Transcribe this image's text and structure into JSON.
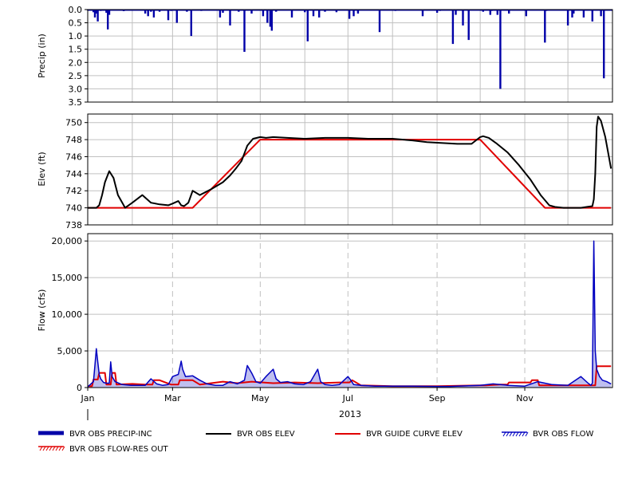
{
  "colors": {
    "precip": "#0000a8",
    "elev": "#000000",
    "guide": "#e00000",
    "flow": "#0000c0",
    "flow_res_out": "#e00000",
    "grid": "#c0c0c0"
  },
  "chart_data": [
    {
      "type": "bar",
      "panel": "precip",
      "ylabel": "Precip (in)",
      "ylim": [
        0.0,
        3.5
      ],
      "y_inverted": true,
      "yticks": [
        "0.0",
        "0.5",
        "1.0",
        "1.5",
        "2.0",
        "2.5",
        "3.0",
        "3.5"
      ],
      "grid": true,
      "series": [
        {
          "name": "BVR OBS PRECIP-INC",
          "x": [
            "2013-01-01",
            "2013-01-05",
            "2013-01-06",
            "2013-01-07",
            "2013-01-08",
            "2013-01-10",
            "2013-01-14",
            "2013-01-15",
            "2013-01-16",
            "2013-01-26",
            "2013-02-10",
            "2013-02-12",
            "2013-02-14",
            "2013-02-16",
            "2013-02-20",
            "2013-02-26",
            "2013-02-28",
            "2013-03-04",
            "2013-03-11",
            "2013-03-14",
            "2013-03-21",
            "2013-04-03",
            "2013-04-05",
            "2013-04-10",
            "2013-04-16",
            "2013-04-20",
            "2013-04-25",
            "2013-05-03",
            "2013-05-06",
            "2013-05-08",
            "2013-05-09",
            "2013-05-12",
            "2013-05-23",
            "2013-06-01",
            "2013-06-03",
            "2013-06-07",
            "2013-06-11",
            "2013-06-15",
            "2013-06-23",
            "2013-07-02",
            "2013-07-05",
            "2013-07-08",
            "2013-07-23",
            "2013-08-03",
            "2013-08-22",
            "2013-09-01",
            "2013-09-03",
            "2013-09-12",
            "2013-09-14",
            "2013-09-19",
            "2013-09-23",
            "2013-10-03",
            "2013-10-08",
            "2013-10-09",
            "2013-10-13",
            "2013-10-15",
            "2013-10-21",
            "2013-11-02",
            "2013-11-15",
            "2013-11-16",
            "2013-12-01",
            "2013-12-04",
            "2013-12-05",
            "2013-12-12",
            "2013-12-18",
            "2013-12-24",
            "2013-12-26"
          ],
          "values": [
            0.02,
            0.1,
            0.3,
            0.15,
            0.45,
            0.05,
            0.12,
            0.75,
            0.2,
            0.06,
            0.15,
            0.25,
            0.08,
            0.3,
            0.08,
            0.4,
            0.05,
            0.5,
            0.08,
            1.0,
            0.05,
            0.3,
            0.12,
            0.6,
            0.08,
            1.6,
            0.15,
            0.25,
            0.5,
            0.65,
            0.8,
            0.08,
            0.3,
            0.1,
            1.2,
            0.25,
            0.3,
            0.08,
            0.1,
            0.35,
            0.25,
            0.15,
            0.85,
            0.05,
            0.25,
            0.12,
            0.05,
            1.3,
            0.2,
            0.6,
            1.15,
            0.08,
            0.2,
            0.05,
            0.2,
            3.0,
            0.15,
            0.25,
            1.25,
            0.05,
            0.6,
            0.3,
            0.15,
            0.3,
            0.45,
            0.25,
            2.6
          ]
        }
      ]
    },
    {
      "type": "line",
      "panel": "elev",
      "ylabel": "Elev (ft)",
      "ylim": [
        738,
        751
      ],
      "yticks": [
        "738",
        "740",
        "742",
        "744",
        "746",
        "748",
        "750"
      ],
      "grid": true,
      "series": [
        {
          "name": "BVR OBS ELEV",
          "x": [
            "2013-01-01",
            "2013-01-07",
            "2013-01-09",
            "2013-01-11",
            "2013-01-13",
            "2013-01-16",
            "2013-01-19",
            "2013-01-22",
            "2013-01-27",
            "2013-02-01",
            "2013-02-08",
            "2013-02-14",
            "2013-02-20",
            "2013-02-26",
            "2013-03-01",
            "2013-03-05",
            "2013-03-07",
            "2013-03-09",
            "2013-03-12",
            "2013-03-15",
            "2013-03-20",
            "2013-03-28",
            "2013-04-05",
            "2013-04-10",
            "2013-04-14",
            "2013-04-18",
            "2013-04-22",
            "2013-04-26",
            "2013-05-01",
            "2013-05-05",
            "2013-05-10",
            "2013-05-20",
            "2013-06-01",
            "2013-06-15",
            "2013-07-01",
            "2013-07-15",
            "2013-08-01",
            "2013-08-15",
            "2013-08-25",
            "2013-09-05",
            "2013-09-15",
            "2013-09-25",
            "2013-10-01",
            "2013-10-03",
            "2013-10-07",
            "2013-10-12",
            "2013-10-20",
            "2013-10-28",
            "2013-11-05",
            "2013-11-12",
            "2013-11-18",
            "2013-11-22",
            "2013-11-28",
            "2013-12-05",
            "2013-12-10",
            "2013-12-14",
            "2013-12-18",
            "2013-12-19",
            "2013-12-20",
            "2013-12-21",
            "2013-12-22",
            "2013-12-24",
            "2013-12-27",
            "2013-12-31"
          ],
          "values": [
            740.0,
            740.0,
            740.3,
            741.5,
            743.0,
            744.3,
            743.5,
            741.5,
            740.0,
            740.6,
            741.5,
            740.6,
            740.4,
            740.3,
            740.5,
            740.8,
            740.3,
            740.2,
            740.6,
            742.0,
            741.5,
            742.2,
            743.0,
            743.8,
            744.6,
            745.5,
            747.3,
            748.1,
            748.3,
            748.2,
            748.3,
            748.2,
            748.1,
            748.2,
            748.2,
            748.1,
            748.1,
            747.9,
            747.7,
            747.6,
            747.5,
            747.5,
            748.3,
            748.4,
            748.2,
            747.6,
            746.5,
            745.0,
            743.3,
            741.5,
            740.3,
            740.1,
            740.0,
            740.0,
            740.0,
            740.1,
            740.2,
            741.0,
            744.0,
            749.5,
            750.7,
            750.2,
            748.3,
            744.6
          ]
        },
        {
          "name": "BVR GUIDE CURVE ELEV",
          "x": [
            "2013-01-01",
            "2013-03-15",
            "2013-05-01",
            "2013-10-01",
            "2013-11-15",
            "2013-12-31"
          ],
          "values": [
            740.0,
            740.0,
            748.0,
            748.0,
            740.0,
            740.0
          ]
        }
      ]
    },
    {
      "type": "line",
      "panel": "flow",
      "ylabel": "Flow (cfs)",
      "ylim": [
        0,
        21000
      ],
      "yticks": [
        "0",
        "5,000",
        "10,000",
        "15,000",
        "20,000"
      ],
      "grid": true,
      "xticks": [
        "Jan",
        "Mar",
        "May",
        "Jul",
        "Sep",
        "Nov"
      ],
      "xlabel": "2013",
      "series": [
        {
          "name": "BVR OBS FLOW",
          "x": [
            "2013-01-01",
            "2013-01-05",
            "2013-01-06",
            "2013-01-07",
            "2013-01-08",
            "2013-01-09",
            "2013-01-10",
            "2013-01-12",
            "2013-01-14",
            "2013-01-16",
            "2013-01-17",
            "2013-01-18",
            "2013-01-20",
            "2013-01-25",
            "2013-01-31",
            "2013-02-05",
            "2013-02-10",
            "2013-02-14",
            "2013-02-18",
            "2013-02-22",
            "2013-02-26",
            "2013-03-01",
            "2013-03-05",
            "2013-03-07",
            "2013-03-08",
            "2013-03-10",
            "2013-03-15",
            "2013-03-20",
            "2013-03-25",
            "2013-03-31",
            "2013-04-05",
            "2013-04-10",
            "2013-04-15",
            "2013-04-20",
            "2013-04-22",
            "2013-04-25",
            "2013-04-28",
            "2013-05-01",
            "2013-05-05",
            "2013-05-10",
            "2013-05-12",
            "2013-05-15",
            "2013-05-20",
            "2013-05-25",
            "2013-05-31",
            "2013-06-05",
            "2013-06-10",
            "2013-06-12",
            "2013-06-15",
            "2013-06-20",
            "2013-06-25",
            "2013-07-01",
            "2013-07-03",
            "2013-07-05",
            "2013-07-10",
            "2013-07-20",
            "2013-08-01",
            "2013-08-15",
            "2013-09-01",
            "2013-09-10",
            "2013-09-15",
            "2013-10-01",
            "2013-10-10",
            "2013-10-15",
            "2013-10-20",
            "2013-11-01",
            "2013-11-10",
            "2013-11-15",
            "2013-11-20",
            "2013-12-01",
            "2013-12-10",
            "2013-12-15",
            "2013-12-17",
            "2013-12-18",
            "2013-12-19",
            "2013-12-20",
            "2013-12-21",
            "2013-12-23",
            "2013-12-25",
            "2013-12-28",
            "2013-12-31"
          ],
          "values": [
            100,
            800,
            3000,
            5300,
            3500,
            1800,
            1200,
            700,
            600,
            600,
            3500,
            1500,
            800,
            400,
            300,
            300,
            300,
            1200,
            500,
            300,
            400,
            1500,
            1800,
            3600,
            2500,
            1500,
            1600,
            1000,
            500,
            300,
            300,
            800,
            500,
            1000,
            3000,
            2000,
            800,
            600,
            1500,
            2500,
            1200,
            700,
            800,
            500,
            400,
            800,
            2500,
            800,
            400,
            300,
            400,
            1500,
            1000,
            400,
            300,
            200,
            200,
            200,
            150,
            150,
            200,
            300,
            500,
            400,
            300,
            200,
            800,
            600,
            400,
            300,
            1500,
            600,
            300,
            600,
            20000,
            5000,
            2500,
            1500,
            1000,
            800,
            500
          ]
        },
        {
          "name": "BVR OBS FLOW-RES OUT",
          "x": [
            "2013-01-01",
            "2013-01-04",
            "2013-01-05",
            "2013-01-08",
            "2013-01-09",
            "2013-01-13",
            "2013-01-14",
            "2013-01-17",
            "2013-01-18",
            "2013-01-20",
            "2013-01-21",
            "2013-02-01",
            "2013-02-10",
            "2013-02-15",
            "2013-02-16",
            "2013-02-20",
            "2013-02-28",
            "2013-03-05",
            "2013-03-06",
            "2013-03-15",
            "2013-03-20",
            "2013-04-05",
            "2013-04-15",
            "2013-04-25",
            "2013-05-10",
            "2013-05-25",
            "2013-06-10",
            "2013-06-25",
            "2013-07-02",
            "2013-07-04",
            "2013-07-10",
            "2013-08-01",
            "2013-09-01",
            "2013-10-01",
            "2013-10-05",
            "2013-10-15",
            "2013-10-20",
            "2013-10-21",
            "2013-11-05",
            "2013-11-06",
            "2013-11-10",
            "2013-11-11",
            "2013-11-20",
            "2013-12-01",
            "2013-12-10",
            "2013-12-15",
            "2013-12-18",
            "2013-12-20",
            "2013-12-21",
            "2013-12-31"
          ],
          "values": [
            200,
            200,
            1100,
            1100,
            2000,
            2000,
            400,
            400,
            2000,
            2000,
            400,
            500,
            400,
            400,
            1000,
            1000,
            400,
            400,
            1000,
            1000,
            400,
            800,
            600,
            800,
            600,
            700,
            600,
            700,
            700,
            1000,
            300,
            200,
            200,
            300,
            300,
            400,
            400,
            700,
            700,
            1000,
            1000,
            300,
            300,
            300,
            300,
            300,
            300,
            300,
            2900,
            2900
          ]
        }
      ]
    }
  ],
  "legend": [
    {
      "label": "BVR OBS PRECIP-INC",
      "style": "thick-blue"
    },
    {
      "label": "BVR OBS ELEV",
      "style": "black-line"
    },
    {
      "label": "BVR GUIDE CURVE ELEV",
      "style": "red-line"
    },
    {
      "label": "BVR OBS FLOW",
      "style": "blue-hatch"
    },
    {
      "label": "BVR OBS FLOW-RES OUT",
      "style": "red-hatch"
    }
  ]
}
